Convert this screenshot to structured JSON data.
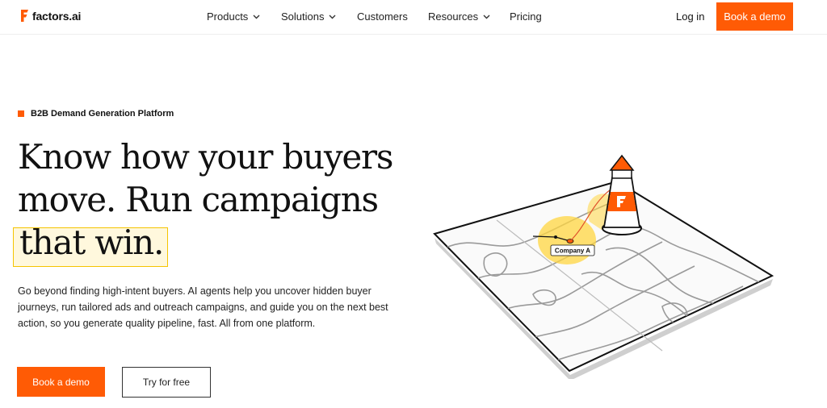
{
  "nav": {
    "brand": "factors.ai",
    "items": [
      {
        "label": "Products",
        "has_dropdown": true
      },
      {
        "label": "Solutions",
        "has_dropdown": true
      },
      {
        "label": "Customers",
        "has_dropdown": false
      },
      {
        "label": "Resources",
        "has_dropdown": true
      },
      {
        "label": "Pricing",
        "has_dropdown": false
      }
    ],
    "login": "Log in",
    "cta": "Book a demo",
    "chevron_icon": "chevron-down-icon"
  },
  "hero": {
    "badge": "B2B Demand Generation Platform",
    "headline_line1": "Know how your buyers",
    "headline_line2": "move. Run campaigns",
    "headline_line3": "that win.",
    "description": "Go beyond finding high-intent buyers. AI agents help you uncover hidden buyer journeys, run tailored ads and outreach campaigns, and guide you on the next best action, so you generate quality pipeline, fast. All from one platform.",
    "primary_cta": "Book a demo",
    "secondary_cta": "Try for free"
  },
  "illustration": {
    "marker_label": "Company A",
    "icons": [
      "topographic-map-icon",
      "lighthouse-icon"
    ]
  },
  "colors": {
    "accent": "#ff5b05",
    "highlight": "#ffd640"
  }
}
